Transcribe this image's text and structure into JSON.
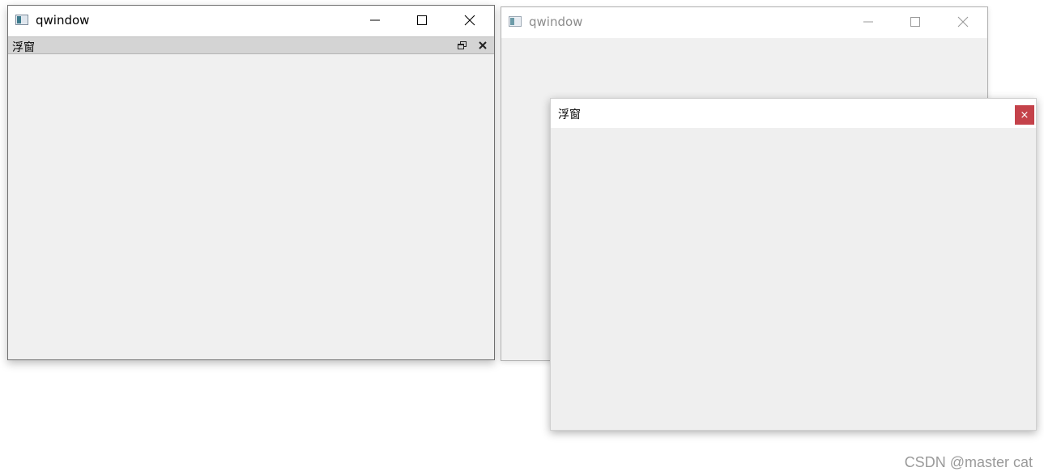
{
  "left_window": {
    "title": "qwindow",
    "icon": "app-window-icon",
    "controls": [
      "minimize-icon",
      "maximize-icon",
      "close-icon"
    ],
    "dock": {
      "title": "浮窗",
      "buttons": [
        "float-restore-icon",
        "close-icon"
      ]
    }
  },
  "right_window": {
    "title": "qwindow",
    "icon": "app-window-icon",
    "controls": [
      "minimize-icon",
      "maximize-icon",
      "close-icon"
    ]
  },
  "floating_window": {
    "title": "浮窗",
    "close_label": "×",
    "close_color": "#c4424a"
  },
  "watermark": "CSDN @master cat"
}
